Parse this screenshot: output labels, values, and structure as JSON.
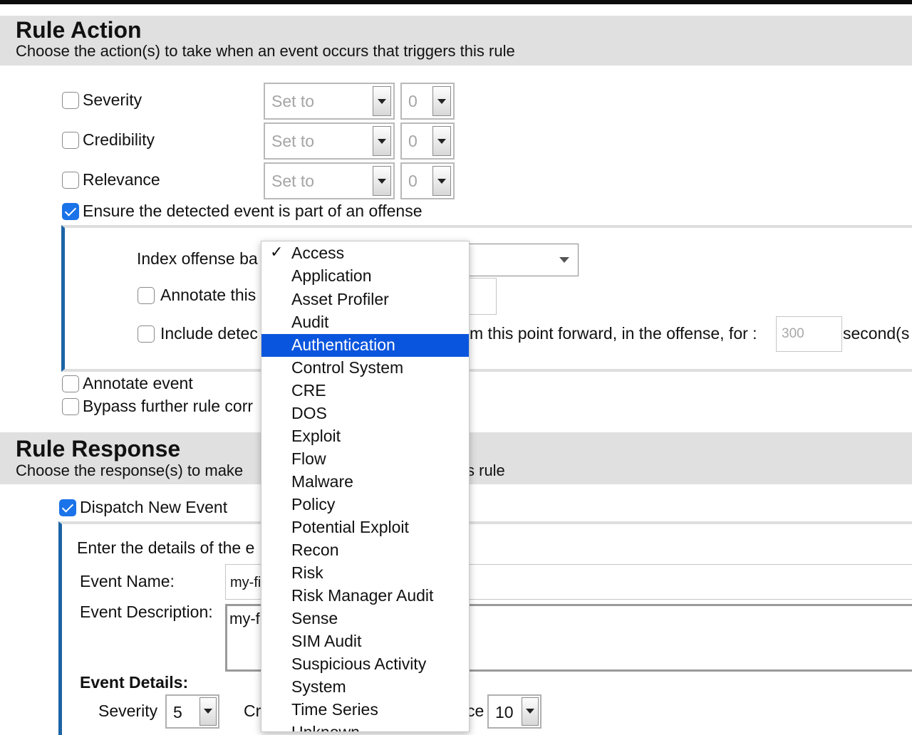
{
  "rule_action": {
    "title": "Rule Action",
    "subtitle": "Choose the action(s) to take when an event occurs that triggers this rule",
    "severity": {
      "label": "Severity",
      "checked": false,
      "mode": "Set to",
      "value": "0"
    },
    "credibility": {
      "label": "Credibility",
      "checked": false,
      "mode": "Set to",
      "value": "0"
    },
    "relevance": {
      "label": "Relevance",
      "checked": false,
      "mode": "Set to",
      "value": "0"
    },
    "ensure_offense": {
      "label": "Ensure the detected event is part of an offense",
      "checked": true
    },
    "offense_panel": {
      "index_label": "Index offense ba",
      "annotate_label": "Annotate this",
      "include_label": "Include detec",
      "include_suffix": "m this point forward, in the offense, for :",
      "seconds_placeholder": "300",
      "seconds_unit": "second(s"
    },
    "annotate_event": {
      "label": "Annotate event",
      "checked": false
    },
    "bypass": {
      "label": "Bypass further rule corr",
      "checked": false
    }
  },
  "rule_response": {
    "title": "Rule Response",
    "subtitle_left": "Choose the response(s) to make",
    "subtitle_right": "s rule",
    "dispatch": {
      "label": "Dispatch New Event",
      "checked": true
    },
    "details_intro": "Enter the details of the e",
    "event_name_label": "Event Name:",
    "event_name_value": "my-fi",
    "event_desc_label": "Event Description:",
    "event_desc_value": "my-f",
    "event_details_label": "Event Details:",
    "severity_label": "Severity",
    "severity_value": "5",
    "cr_label": "Cr",
    "ce_label": "ce",
    "right_value": "10"
  },
  "dropdown": {
    "selected": "Access",
    "highlighted": "Authentication",
    "check_glyph": "✓",
    "items": [
      "Access",
      "Application",
      "Asset Profiler",
      "Audit",
      "Authentication",
      "Control System",
      "CRE",
      "DOS",
      "Exploit",
      "Flow",
      "Malware",
      "Policy",
      "Potential Exploit",
      "Recon",
      "Risk",
      "Risk Manager Audit",
      "Sense",
      "SIM Audit",
      "Suspicious Activity",
      "System",
      "Time Series",
      "Unknown"
    ]
  }
}
